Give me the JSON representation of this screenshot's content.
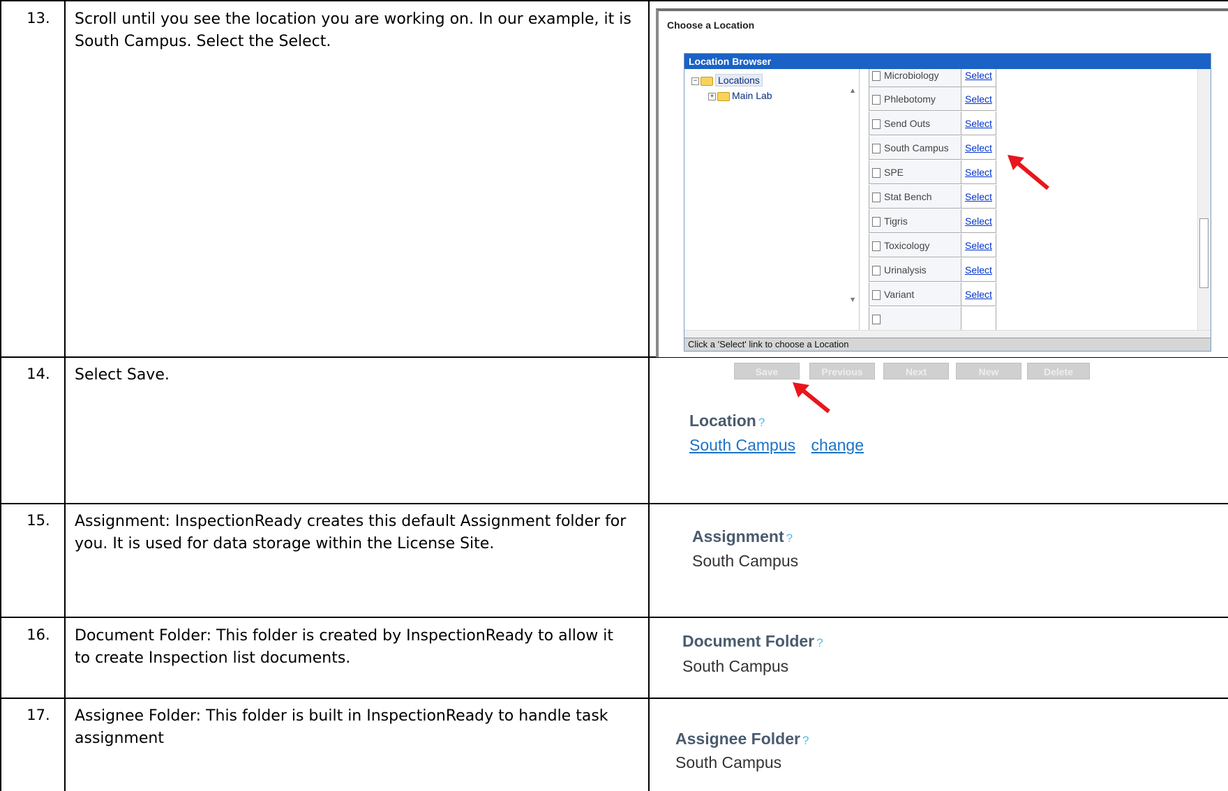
{
  "steps": [
    {
      "number": "13.",
      "text": "Scroll until you see the location you are working on.  In our example, it is South Campus.  Select the Select."
    },
    {
      "number": "14.",
      "text": "Select Save."
    },
    {
      "number": "15.",
      "text": "Assignment:  InspectionReady creates this default Assignment folder for you.  It is used for data storage within the License Site."
    },
    {
      "number": "16.",
      "text": "Document Folder:  This folder is created by InspectionReady to allow it to create Inspection list documents."
    },
    {
      "number": "17.",
      "text": "Assignee Folder:  This folder is built in InspectionReady to handle task assignment"
    }
  ],
  "dialog": {
    "title": "Choose a Location",
    "browser_header": "Location Browser",
    "tree": {
      "root": "Locations",
      "child": "Main Lab",
      "expand_symbol": "+",
      "collapse_symbol": "−"
    },
    "select_label": "Select",
    "locations": [
      "Microbiology",
      "Phlebotomy",
      "Send Outs",
      "South Campus",
      "SPE",
      "Stat Bench",
      "Tigris",
      "Toxicology",
      "Urinalysis",
      "Variant"
    ],
    "status": "Click a 'Select' link to choose a Location"
  },
  "toolbar": {
    "buttons": [
      "Save",
      "Previous",
      "Next",
      "New",
      "Delete"
    ]
  },
  "location_field": {
    "label": "Location",
    "help": "?",
    "value": "South Campus",
    "change": "change"
  },
  "assignment_field": {
    "label": "Assignment",
    "help": "?",
    "value": "South Campus"
  },
  "document_field": {
    "label": "Document Folder",
    "help": "?",
    "value": "South Campus"
  },
  "assignee_field": {
    "label": "Assignee Folder",
    "help": "?",
    "value": "South Campus"
  },
  "colors": {
    "accent_arrow": "#e8161c",
    "header_blue": "#1a62c5",
    "link_blue": "#1b74c9"
  }
}
